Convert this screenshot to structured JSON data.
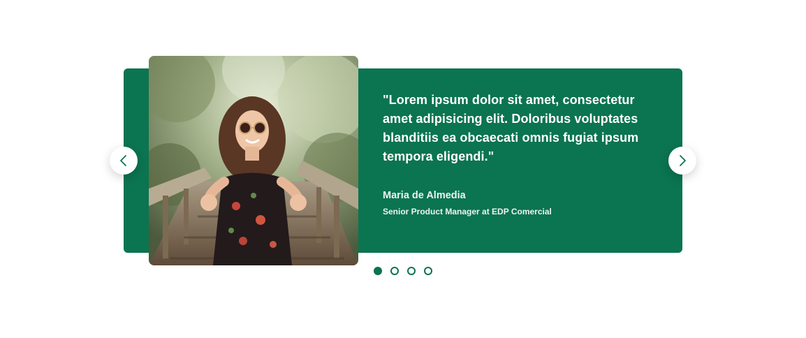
{
  "testimonial": {
    "quote": "\"Lorem ipsum dolor sit amet, consectetur amet adipisicing elit. Doloribus voluptates blanditiis ea obcaecati omnis fugiat ipsum tempora eligendi.\"",
    "author_name": "Maria de Almedia",
    "author_role": "Senior Product Manager at EDP Comercial"
  },
  "navigation": {
    "prev_icon": "chevron-left-icon",
    "next_icon": "chevron-right-icon"
  },
  "pagination": {
    "total": 4,
    "active_index": 0
  },
  "colors": {
    "accent": "#0b7450",
    "background": "#ffffff",
    "text_on_accent": "#ffffff"
  }
}
